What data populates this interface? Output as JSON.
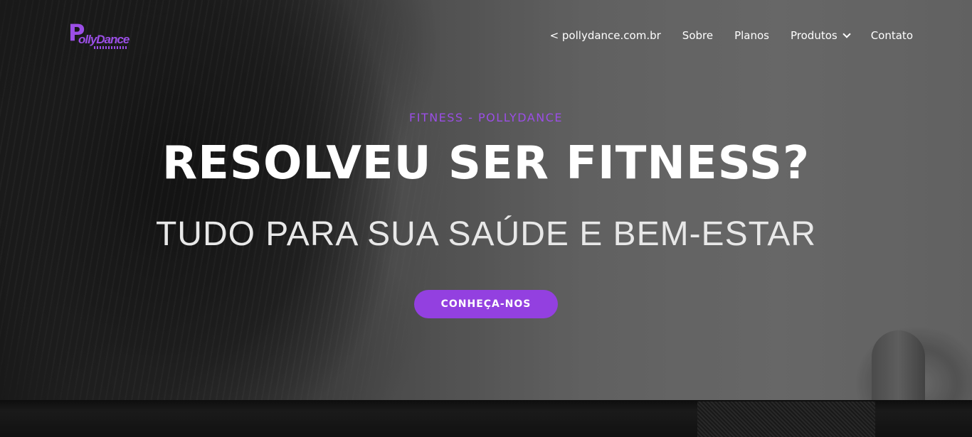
{
  "brand": {
    "logo_letter": "P",
    "logo_text": "ollyDance"
  },
  "nav": {
    "items": [
      {
        "label": "< pollydance.com.br"
      },
      {
        "label": "Sobre"
      },
      {
        "label": "Planos"
      },
      {
        "label": "Produtos",
        "icon": "chevron-down-icon"
      },
      {
        "label": "Contato"
      }
    ]
  },
  "hero": {
    "kicker": "FITNESS - POLLYDANCE",
    "headline": "RESOLVEU SER FITNESS?",
    "subheadline": "TUDO PARA SUA SAÚDE E BEM-ESTAR",
    "cta_label": "CONHEÇA-NOS"
  },
  "colors": {
    "accent": "#9b4ee6",
    "button": "#9340e0",
    "text": "#ffffff"
  }
}
